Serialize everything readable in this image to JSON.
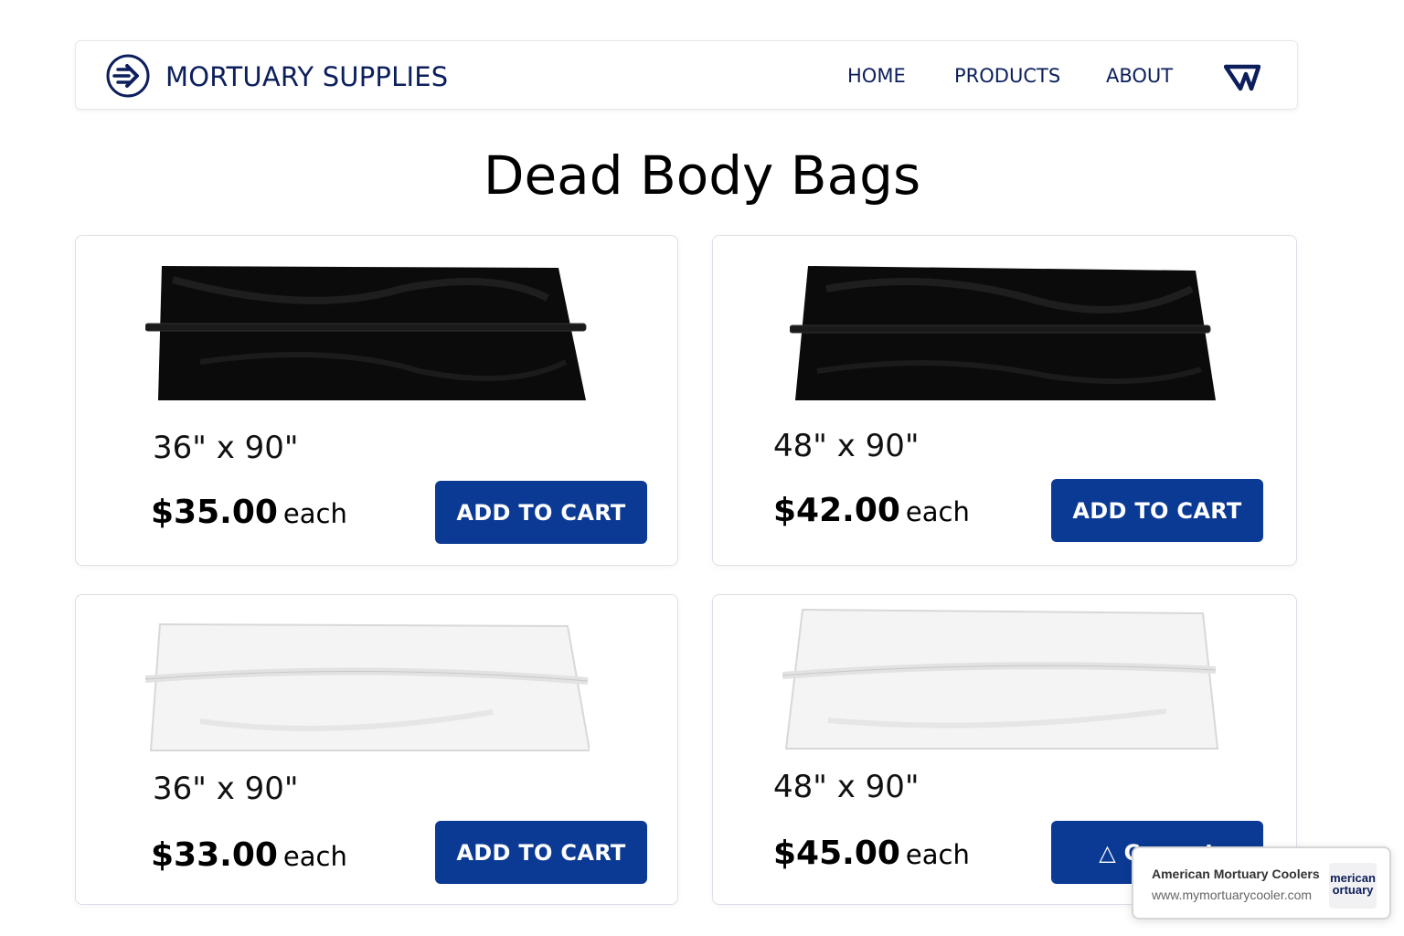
{
  "header": {
    "brand": "MORTUARY SUPPLIES",
    "nav": [
      "HOME",
      "PRODUCTS",
      "ABOUT"
    ],
    "icons": {
      "logo": "arrow-circle-logo",
      "cart": "cart-icon"
    }
  },
  "page": {
    "title": "Dead Body Bags"
  },
  "products": [
    {
      "size": "36\" x 90\"",
      "price": "$35.00",
      "unit": "each",
      "button": "ADD TO CART",
      "color": "#0a0a0a"
    },
    {
      "size": "48\" x 90\"",
      "price": "$42.00",
      "unit": "each",
      "button": "ADD TO CART",
      "color": "#0a0a0a"
    },
    {
      "size": "36\" x 90\"",
      "price": "$33.00",
      "unit": "each",
      "button": "ADD TO CART",
      "color": "#f2f2f2"
    },
    {
      "size": "48\" x 90\"",
      "price": "$45.00",
      "unit": "each",
      "button": "△ Cremat",
      "color": "#f2f2f2"
    }
  ],
  "toast": {
    "title": "American Mortuary Coolers",
    "url": "www.mymortuarycooler.com",
    "logo_text": [
      "merican",
      "ortuary"
    ]
  },
  "colors": {
    "accent": "#0b3a94",
    "brand": "#0c1f5c"
  }
}
